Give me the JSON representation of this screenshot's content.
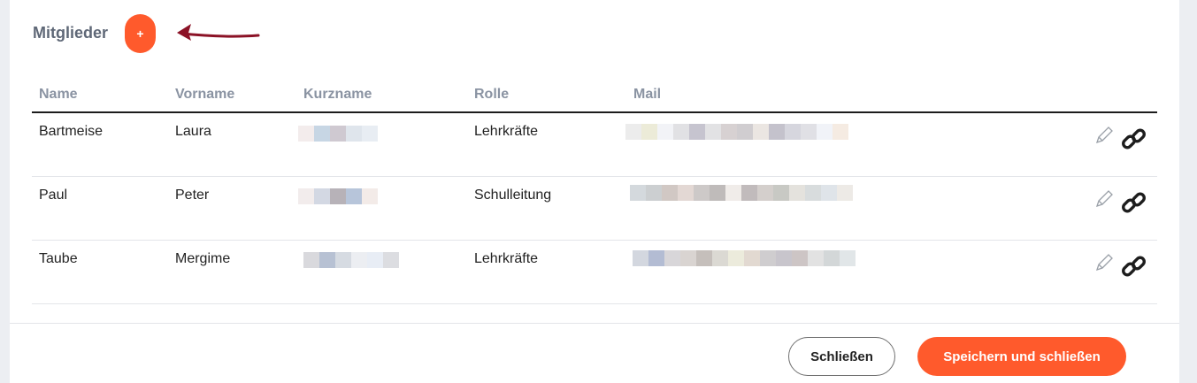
{
  "section": {
    "title": "Mitglieder",
    "add_label": "+"
  },
  "colors": {
    "accent": "#ff5a2c",
    "arrow": "#8b1226",
    "heading": "#5f6877",
    "column_header": "#8a93a2"
  },
  "table": {
    "columns": [
      "Name",
      "Vorname",
      "Kurzname",
      "Rolle",
      "Mail"
    ],
    "rows": [
      {
        "name": "Bartmeise",
        "vorname": "Laura",
        "kurzname": "",
        "rolle": "Lehrkräfte",
        "mail": ""
      },
      {
        "name": "Paul",
        "vorname": "Peter",
        "kurzname": "",
        "rolle": "Schulleitung",
        "mail": ""
      },
      {
        "name": "Taube",
        "vorname": "Mergime",
        "kurzname": "",
        "rolle": "Lehrkräfte",
        "mail": ""
      }
    ],
    "row_actions": [
      "pencil-icon",
      "link-icon"
    ]
  },
  "footer": {
    "close_label": "Schließen",
    "save_label": "Speichern und schließen"
  }
}
